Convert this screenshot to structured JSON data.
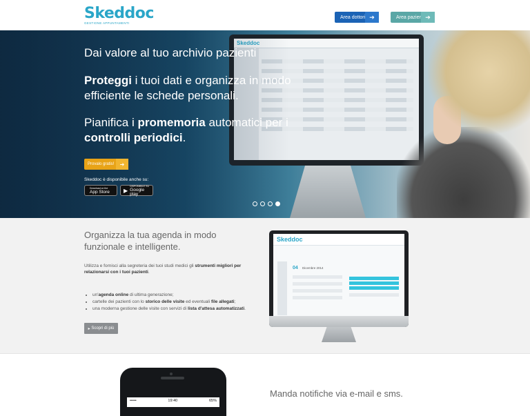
{
  "header": {
    "logo_text": "Skeddoc",
    "logo_subtitle": "GESTIONE APPUNTAMENTI",
    "btn_doctors": "Area dottori",
    "btn_patients": "Area pazienti"
  },
  "hero": {
    "title": "Dai valore al tuo archivio pazienti",
    "p1_bold": "Proteggi",
    "p1_rest": " i tuoi dati e organizza in modo efficiente le schede personali.",
    "p2_a": "Pianifica i ",
    "p2_bold1": "promemoria",
    "p2_b": " automatici per i ",
    "p2_bold2": "controlli periodici",
    "p2_c": ".",
    "try_button": "Provalo gratis!",
    "available": "Skeddoc è disponibile anche su:",
    "appstore_small": "Download on the",
    "appstore": "App Store",
    "googleplay_small": "DISPONIBILE SU",
    "googleplay": "Google play",
    "slides": 4,
    "active_slide": 4
  },
  "section2": {
    "title": "Organizza la tua agenda in modo funzionale e intelligente.",
    "text_a": "Utilizza e fornisci alla segreteria dei tuoi studi medici gli ",
    "text_bold": "strumenti migliori per relazionarsi con i tuoi pazienti",
    "text_b": ".",
    "li1_a": "un'",
    "li1_bold": "agenda online",
    "li1_b": " di ultima generazione;",
    "li2_a": "cartelle dei pazienti con lo ",
    "li2_bold1": "storico delle visite",
    "li2_b": " ed eventuali ",
    "li2_bold2": "file allegati",
    "li2_c": ";",
    "li3_a": "una moderna gestione delle visite con servizi di ",
    "li3_bold": "lista d'attesa automatizzati",
    "li3_b": ".",
    "more_button": "Scopri di più",
    "screen_logo": "Skeddoc",
    "screen_day": "04",
    "screen_date": "Dicembre 2014"
  },
  "section3": {
    "title": "Manda notifiche via e-mail e sms.",
    "phone_time": "19:40",
    "phone_battery": "65%"
  },
  "colors": {
    "brand": "#2aa6c8",
    "btn_doctors": "#1b63b5",
    "btn_patients": "#5aa7a6",
    "try": "#e8a317"
  }
}
